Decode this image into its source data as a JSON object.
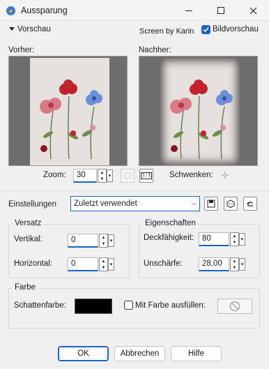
{
  "window": {
    "title": "Aussparung"
  },
  "preview": {
    "section_label": "Vorschau",
    "credit": "Screen by Karin",
    "live_preview_label": "Bildvorschau",
    "before_label": "Vorher:",
    "after_label": "Nachher:",
    "zoom_label": "Zoom:",
    "zoom_value": "30",
    "pan_label": "Schwenken:"
  },
  "settings": {
    "label": "Einstellungen",
    "preset": "Zuletzt verwendet"
  },
  "offset": {
    "title": "Versatz",
    "vertical_label": "Vertikal:",
    "vertical_value": "0",
    "horizontal_label": "Horizontal:",
    "horizontal_value": "0"
  },
  "properties": {
    "title": "Eigenschaften",
    "opacity_label": "Deckfähigkeit:",
    "opacity_value": "80",
    "blur_label": "Unschärfe:",
    "blur_value": "28,00"
  },
  "color": {
    "title": "Farbe",
    "shadow_label": "Schattenfarbe:",
    "shadow_color": "#000000",
    "fill_label": "Mit Farbe ausfüllen:"
  },
  "buttons": {
    "ok": "OK",
    "cancel": "Abbrechen",
    "help": "Hilfe"
  }
}
